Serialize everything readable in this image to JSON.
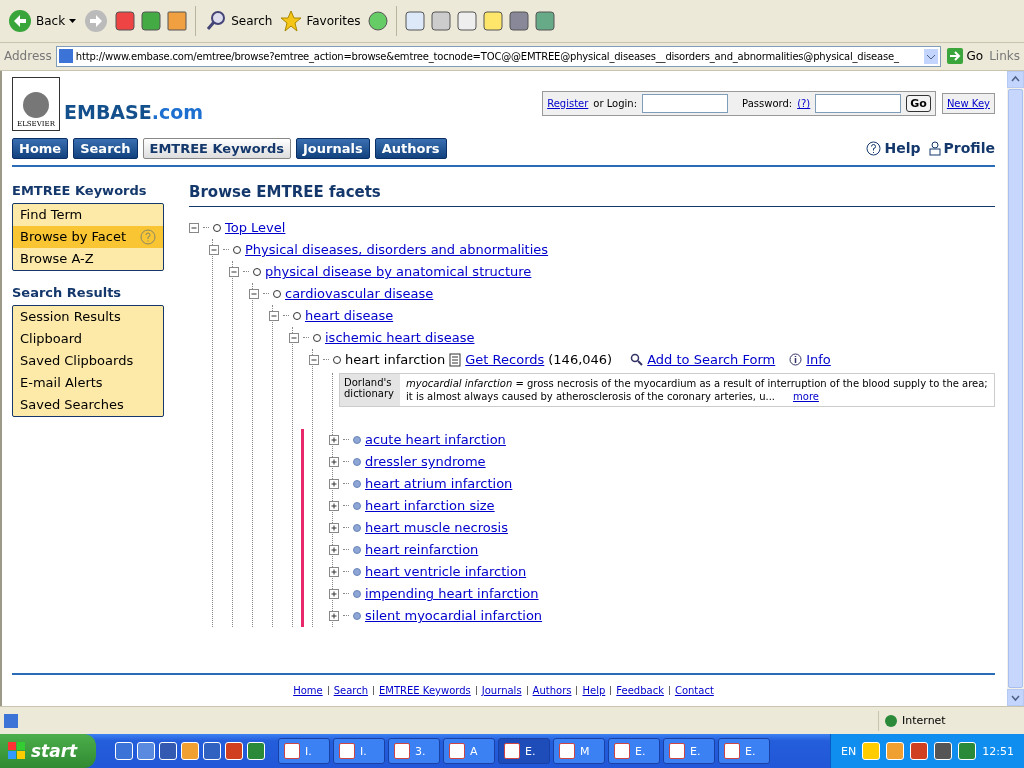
{
  "toolbar": {
    "back": "Back",
    "search": "Search",
    "favorites": "Favorites"
  },
  "address_bar": {
    "label": "Address",
    "url": "http://www.embase.com/emtree/browse?emtree_action=browse&emtree_tocnode=TOC@@EMTREE@physical_diseases__disorders_and_abnormalities@physical_disease_",
    "go": "Go",
    "links": "Links"
  },
  "header": {
    "publisher": "ELSEVIER",
    "brand": "EMBASE",
    "brand_suffix": ".com",
    "login": {
      "register": "Register",
      "or_login": "or Login:",
      "password": "Password:",
      "password_help": "(?)",
      "go": "Go",
      "new_key": "New Key"
    }
  },
  "nav_tabs": [
    {
      "label": "Home",
      "selected": false
    },
    {
      "label": "Search",
      "selected": false
    },
    {
      "label": "EMTREE Keywords",
      "selected": true
    },
    {
      "label": "Journals",
      "selected": false
    },
    {
      "label": "Authors",
      "selected": false
    }
  ],
  "utility_links": {
    "help": "Help",
    "profile": "Profile"
  },
  "sidebar": [
    {
      "title": "EMTREE Keywords",
      "items": [
        {
          "label": "Find Term",
          "selected": false
        },
        {
          "label": "Browse by Facet",
          "selected": true
        },
        {
          "label": "Browse A-Z",
          "selected": false
        }
      ]
    },
    {
      "title": "Search Results",
      "items": [
        {
          "label": "Session Results",
          "selected": false
        },
        {
          "label": "Clipboard",
          "selected": false
        },
        {
          "label": "Saved Clipboards",
          "selected": false
        },
        {
          "label": "E-mail Alerts",
          "selected": false
        },
        {
          "label": "Saved Searches",
          "selected": false
        }
      ]
    }
  ],
  "main": {
    "title": "Browse EMTREE facets",
    "tree": [
      {
        "label": "Top Level",
        "expanded": true,
        "children": [
          {
            "label": "Physical diseases, disorders and abnormalities",
            "expanded": true,
            "children": [
              {
                "label": "physical disease by anatomical structure",
                "expanded": true,
                "children": [
                  {
                    "label": "cardiovascular disease",
                    "expanded": true,
                    "children": [
                      {
                        "label": "heart disease",
                        "expanded": true,
                        "children": [
                          {
                            "label": "ischemic heart disease",
                            "expanded": true,
                            "children": [
                              {
                                "label": "heart infarction",
                                "kind": "current",
                                "expanded": true,
                                "get_records": "Get Records",
                                "count": "(146,046)",
                                "add_to_search": "Add to Search Form",
                                "info": "Info",
                                "definition": {
                                  "source": "Dorland's dictionary",
                                  "text": "*myocardial infarction* = gross necrosis of the myocardium as a result of interruption of the blood supply to the area; it is almost always caused by atherosclerosis of the coronary arteries, u...",
                                  "more": "more"
                                },
                                "children": [
                                  {
                                    "label": "acute heart infarction",
                                    "kind": "narrower",
                                    "expanded": false
                                  },
                                  {
                                    "label": "dressler syndrome",
                                    "kind": "narrower",
                                    "expanded": false
                                  },
                                  {
                                    "label": "heart atrium infarction",
                                    "kind": "narrower",
                                    "expanded": false
                                  },
                                  {
                                    "label": "heart infarction size",
                                    "kind": "narrower",
                                    "expanded": false
                                  },
                                  {
                                    "label": "heart muscle necrosis",
                                    "kind": "narrower",
                                    "expanded": false
                                  },
                                  {
                                    "label": "heart reinfarction",
                                    "kind": "narrower",
                                    "expanded": false
                                  },
                                  {
                                    "label": "heart ventricle infarction",
                                    "kind": "narrower",
                                    "expanded": false
                                  },
                                  {
                                    "label": "impending heart infarction",
                                    "kind": "narrower",
                                    "expanded": false
                                  },
                                  {
                                    "label": "silent myocardial infarction",
                                    "kind": "narrower",
                                    "expanded": false
                                  }
                                ]
                              }
                            ]
                          }
                        ]
                      }
                    ]
                  }
                ]
              }
            ]
          }
        ]
      }
    ]
  },
  "footer_links": [
    "Home",
    "Search",
    "EMTREE Keywords",
    "Journals",
    "Authors",
    "Help",
    "Feedback",
    "Contact"
  ],
  "status_bar": {
    "zone": "Internet"
  },
  "taskbar": {
    "start": "start",
    "tasks": [
      {
        "label": "I.",
        "selected": false
      },
      {
        "label": "I.",
        "selected": false
      },
      {
        "label": "3.",
        "selected": false
      },
      {
        "label": "A",
        "selected": false
      },
      {
        "label": "E.",
        "selected": true
      },
      {
        "label": "M",
        "selected": false
      },
      {
        "label": "E.",
        "selected": false
      },
      {
        "label": "E.",
        "selected": false
      },
      {
        "label": "E.",
        "selected": false
      }
    ],
    "language": "EN",
    "clock": "12:51"
  }
}
